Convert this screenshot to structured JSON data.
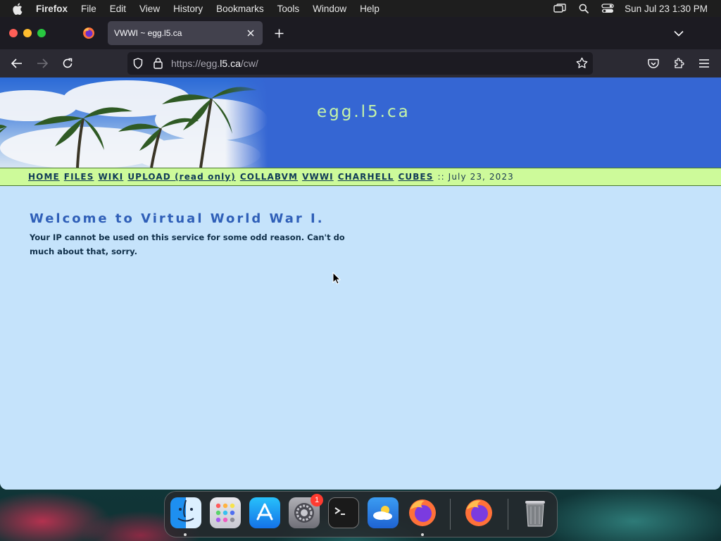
{
  "menubar": {
    "items": [
      "Firefox",
      "File",
      "Edit",
      "View",
      "History",
      "Bookmarks",
      "Tools",
      "Window",
      "Help"
    ],
    "clock": "Sun Jul 23  1:30 PM"
  },
  "browser": {
    "active_tab_title": "VWWI ~ egg.l5.ca",
    "url_prefix": "https://egg.",
    "url_host": "l5.ca",
    "url_path": "/cw/"
  },
  "page": {
    "site_title": "egg.l5.ca",
    "nav_links": [
      "HOME",
      "FILES",
      "WIKI",
      "UPLOAD (read only)",
      "COLLABVM",
      "VWWI",
      "CHARHELL",
      "CUBES"
    ],
    "date": ":: July 23, 2023",
    "heading": "Welcome to Virtual World War I.",
    "message": "Your IP cannot be used on this service for some odd reason. Can't do much about that, sorry."
  },
  "dock": {
    "settings_badge": "1"
  },
  "colors": {
    "banner_blue": "#3566d3",
    "nav_strip_green": "#cdfa9a",
    "page_background": "#c5e3fb",
    "heading_blue": "#2f5fb8"
  }
}
